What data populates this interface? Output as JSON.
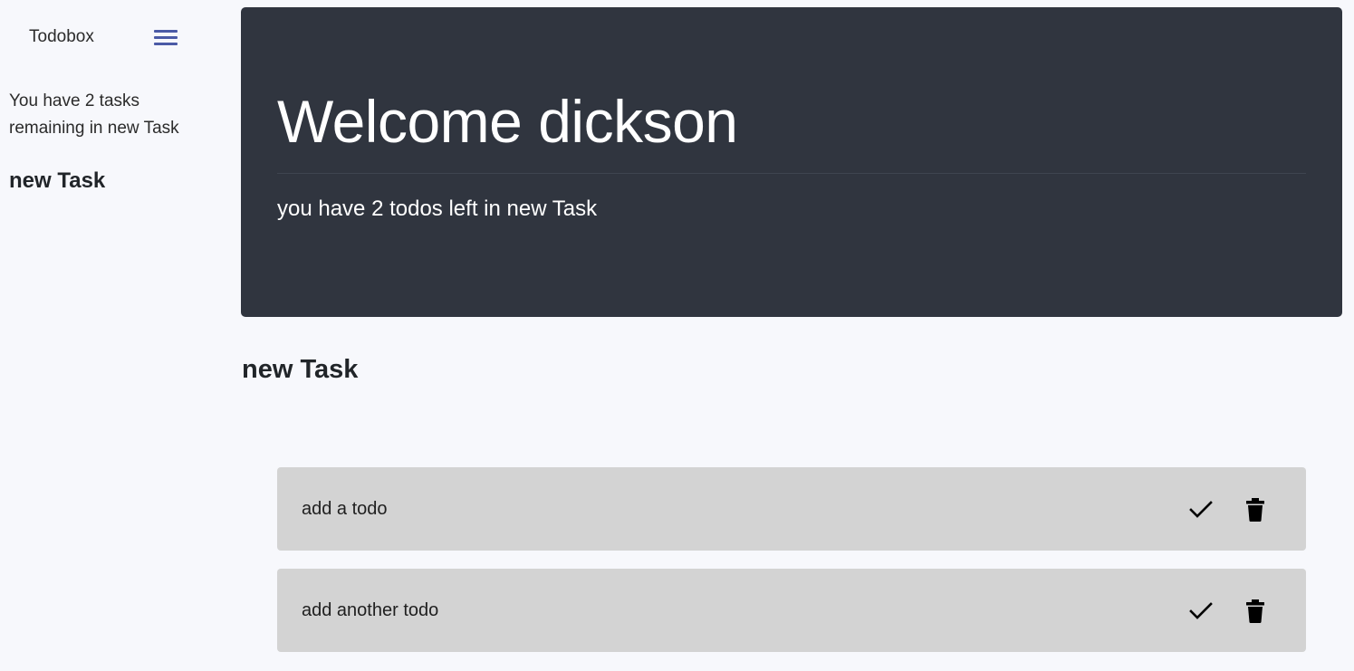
{
  "sidebar": {
    "brand": "Todobox",
    "menu_icon": "hamburger-menu-icon",
    "remaining_text": "You have 2 tasks remaining in new Task",
    "task_name": "new Task"
  },
  "hero": {
    "title": "Welcome dickson",
    "subtitle": "you have 2 todos left in new Task",
    "background": "#30353f"
  },
  "main": {
    "section_title": "new Task",
    "todos": [
      {
        "text": "add a todo",
        "done_icon": "checkmark-icon",
        "delete_icon": "trash-icon"
      },
      {
        "text": "add another todo",
        "done_icon": "checkmark-icon",
        "delete_icon": "trash-icon"
      }
    ]
  },
  "colors": {
    "page_bg": "#f7f8fc",
    "accent": "#4b5aa6",
    "todo_bg": "#d3d3d3"
  }
}
